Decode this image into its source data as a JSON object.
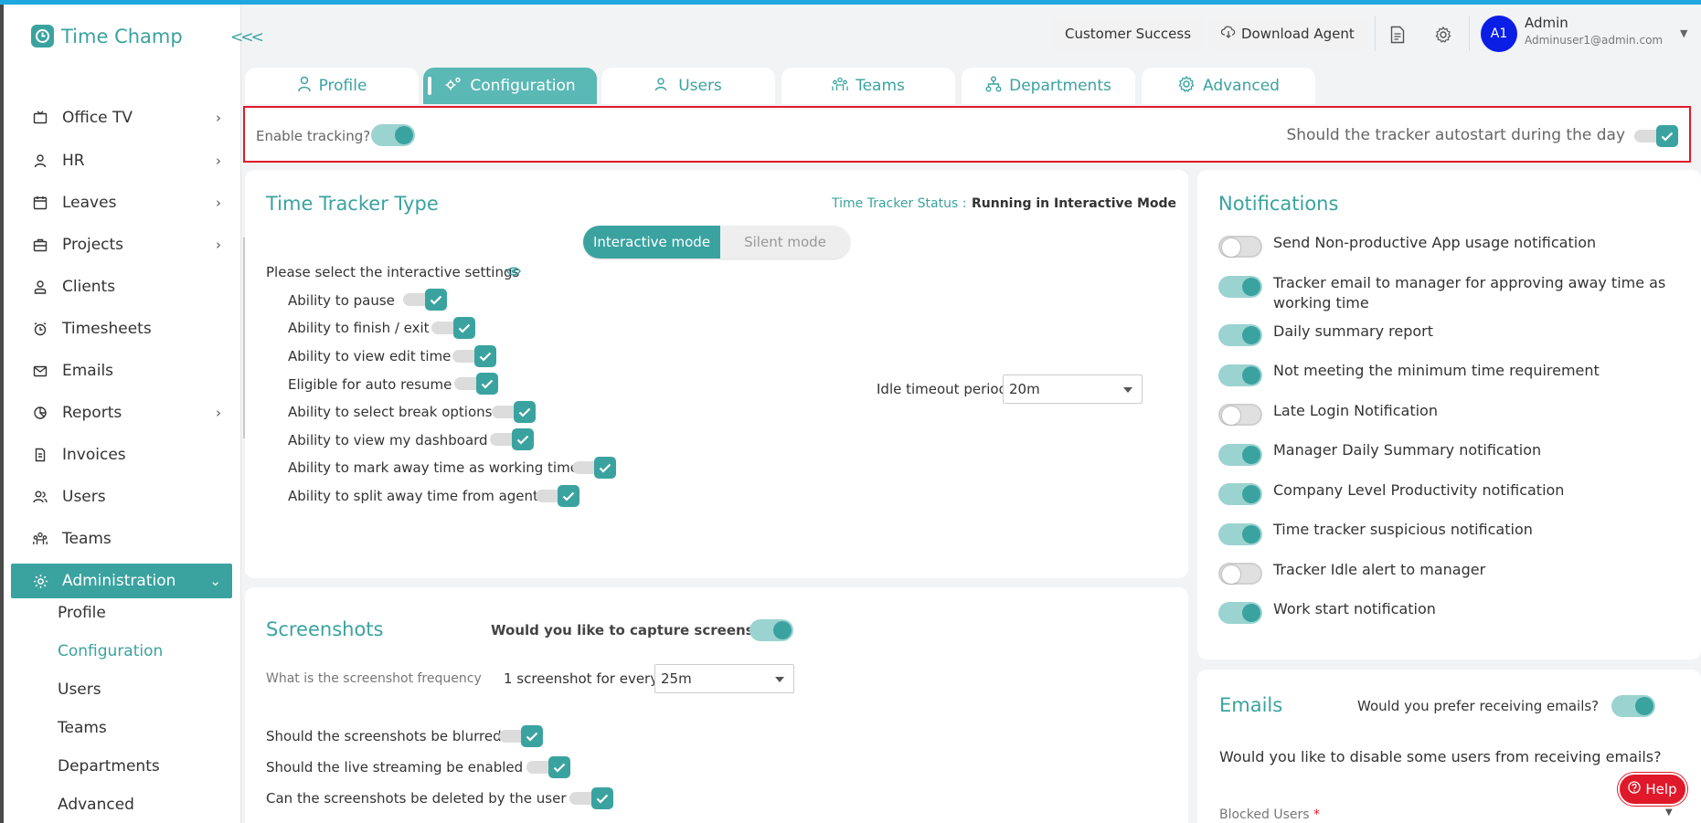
{
  "app": {
    "name": "Time Champ"
  },
  "sidebar": {
    "items": [
      {
        "label": "Office TV"
      },
      {
        "label": "HR"
      },
      {
        "label": "Leaves"
      },
      {
        "label": "Projects"
      },
      {
        "label": "Clients"
      },
      {
        "label": "Timesheets"
      },
      {
        "label": "Emails"
      },
      {
        "label": "Reports"
      },
      {
        "label": "Invoices"
      },
      {
        "label": "Users"
      },
      {
        "label": "Teams"
      },
      {
        "label": "Administration"
      }
    ],
    "sub_items": [
      {
        "label": "Profile"
      },
      {
        "label": "Configuration"
      },
      {
        "label": "Users"
      },
      {
        "label": "Teams"
      },
      {
        "label": "Departments"
      },
      {
        "label": "Advanced"
      }
    ]
  },
  "header": {
    "customer_success": "Customer Success",
    "download_agent": "Download Agent",
    "user": {
      "initials": "A1",
      "name": "Admin",
      "email": "Adminuser1@admin.com"
    }
  },
  "tabs": [
    {
      "label": "Profile"
    },
    {
      "label": "Configuration"
    },
    {
      "label": "Users"
    },
    {
      "label": "Teams"
    },
    {
      "label": "Departments"
    },
    {
      "label": "Advanced"
    }
  ],
  "enable_bar": {
    "enable_label": "Enable tracking?",
    "enable_on": true,
    "autostart_label": "Should the tracker autostart during the day",
    "autostart_checked": true
  },
  "tracker": {
    "title": "Time Tracker Type",
    "status_label": "Time Tracker Status :",
    "status_value": "Running in Interactive Mode",
    "mode_interactive": "Interactive mode",
    "mode_silent": "Silent mode",
    "settings_heading": "Please select the interactive settings",
    "settings": [
      {
        "label": "Ability to pause",
        "checked": true
      },
      {
        "label": "Ability to finish / exit",
        "checked": true
      },
      {
        "label": "Ability to view edit time",
        "checked": true
      },
      {
        "label": "Eligible for auto resume",
        "checked": true
      },
      {
        "label": "Ability to select break options",
        "checked": true
      },
      {
        "label": "Ability to view my dashboard",
        "checked": true
      },
      {
        "label": "Ability to mark away time as working time",
        "checked": true
      },
      {
        "label": "Ability to split away time from agent",
        "checked": true
      }
    ],
    "idle_label": "Idle timeout period",
    "idle_value": "20m"
  },
  "screenshots": {
    "title": "Screenshots",
    "capture_label": "Would you like to capture screenshots",
    "capture_on": true,
    "frequency_label": "What is the screenshot frequency",
    "every_label": "1 screenshot for every",
    "frequency_value": "25m",
    "options": [
      {
        "label": "Should the screenshots be blurred ?",
        "checked": true
      },
      {
        "label": "Should the live streaming be enabled ?",
        "checked": true
      },
      {
        "label": "Can the screenshots be deleted by the user ?",
        "checked": true
      }
    ]
  },
  "notifications": {
    "title": "Notifications",
    "items": [
      {
        "label": "Send Non-productive App usage notification",
        "on": false
      },
      {
        "label": "Tracker email to manager for approving away time as working time",
        "on": true
      },
      {
        "label": "Daily summary report",
        "on": true
      },
      {
        "label": "Not meeting the minimum time requirement",
        "on": true
      },
      {
        "label": "Late Login Notification",
        "on": false
      },
      {
        "label": "Manager Daily Summary notification",
        "on": true
      },
      {
        "label": "Company Level Productivity notification",
        "on": true
      },
      {
        "label": "Time tracker suspicious notification",
        "on": true
      },
      {
        "label": "Tracker Idle alert to manager",
        "on": false
      },
      {
        "label": "Work start notification",
        "on": true
      }
    ]
  },
  "emails": {
    "title": "Emails",
    "prefer_label": "Would you prefer receiving emails?",
    "prefer_on": true,
    "disable_label": "Would you like to disable some users from receiving emails?",
    "blocked_label": "Blocked Users",
    "required_mark": "*"
  },
  "help": {
    "label": "Help"
  },
  "colors": {
    "accent": "#3aa3a0",
    "accent_light": "#9bd3d1",
    "highlight": "#e0192a",
    "avatar": "#0a1ee6"
  }
}
